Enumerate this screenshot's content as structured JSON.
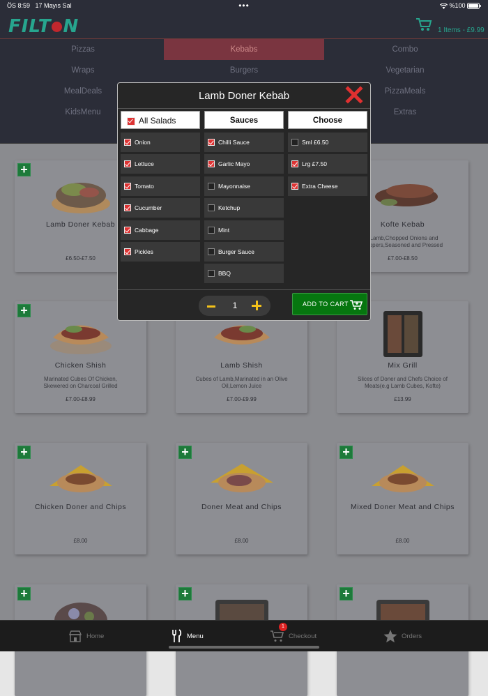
{
  "status_bar": {
    "time": "ÖS 8:59",
    "date": "17 Mayıs Sal",
    "battery": "%100"
  },
  "header": {
    "logo": "FILTON",
    "cart_summary": "1 Items - £9.99"
  },
  "categories": [
    "Pizzas",
    "Kebabs",
    "Combo",
    "Wraps",
    "Burgers",
    "Vegetarian",
    "MealDeals",
    "",
    "PizzaMeals",
    "KidsMenu",
    "",
    "Extras"
  ],
  "selected_category": "Kebabs",
  "products": [
    {
      "name": "Lamb Doner Kebab",
      "desc": "",
      "price": "£6.50-£7.50"
    },
    {
      "name": "",
      "desc": "",
      "price": ""
    },
    {
      "name": "Kofte Kebab",
      "desc": "l Lamb,Chopped Onions and\nPeppers,Seasoned and Pressed",
      "price": "£7.00-£8.50"
    },
    {
      "name": "Chicken Shish",
      "desc": "Marinated Cubes Of Chicken,\nSkewered on Charcoal Grilled",
      "price": "£7.00-£8.99"
    },
    {
      "name": "Lamb Shish",
      "desc": "Cubes of Lamb,Marinated in an Olive\nOil,Lemon Juice",
      "price": "£7.00-£9.99"
    },
    {
      "name": "Mix Grill",
      "desc": "Slices of Doner and Chefs Choice of\nMeats(e.g Lamb Cubes, Kofte)",
      "price": "£13.99"
    },
    {
      "name": "Chicken Doner and Chips",
      "desc": "",
      "price": "£8.00"
    },
    {
      "name": "Doner Meat and Chips",
      "desc": "",
      "price": "£8.00"
    },
    {
      "name": "Mixed Doner Meat and Chips",
      "desc": "",
      "price": "£8.00"
    },
    {
      "name": "",
      "desc": "",
      "price": ""
    },
    {
      "name": "",
      "desc": "",
      "price": ""
    },
    {
      "name": "",
      "desc": "",
      "price": ""
    }
  ],
  "modal": {
    "title": "Lamb Doner Kebab",
    "columns": [
      {
        "header": "All Salads",
        "header_checked": true,
        "options": [
          {
            "label": "Onion",
            "checked": true
          },
          {
            "label": "Lettuce",
            "checked": true
          },
          {
            "label": "Tomato",
            "checked": true
          },
          {
            "label": "Cucumber",
            "checked": true
          },
          {
            "label": "Cabbage",
            "checked": true
          },
          {
            "label": "Pickles",
            "checked": true
          }
        ]
      },
      {
        "header": "Sauces",
        "options": [
          {
            "label": "Chilli Sauce",
            "checked": true
          },
          {
            "label": "Garlic Mayo",
            "checked": true
          },
          {
            "label": "Mayonnaise",
            "checked": false
          },
          {
            "label": "Ketchup",
            "checked": false
          },
          {
            "label": "Mint",
            "checked": false
          },
          {
            "label": "Burger Sauce",
            "checked": false
          },
          {
            "label": "BBQ",
            "checked": false
          }
        ]
      },
      {
        "header": "Choose",
        "options": [
          {
            "label": "Sml £6.50",
            "checked": false
          },
          {
            "label": "Lrg £7.50",
            "checked": true
          },
          {
            "label": "Extra Cheese",
            "checked": true
          }
        ]
      }
    ],
    "quantity": "1",
    "add_to_cart_label": "ADD TO CART"
  },
  "tabbar": {
    "home": "Home",
    "menu": "Menu",
    "checkout": "Checkout",
    "checkout_badge": "1",
    "orders": "Orders"
  }
}
